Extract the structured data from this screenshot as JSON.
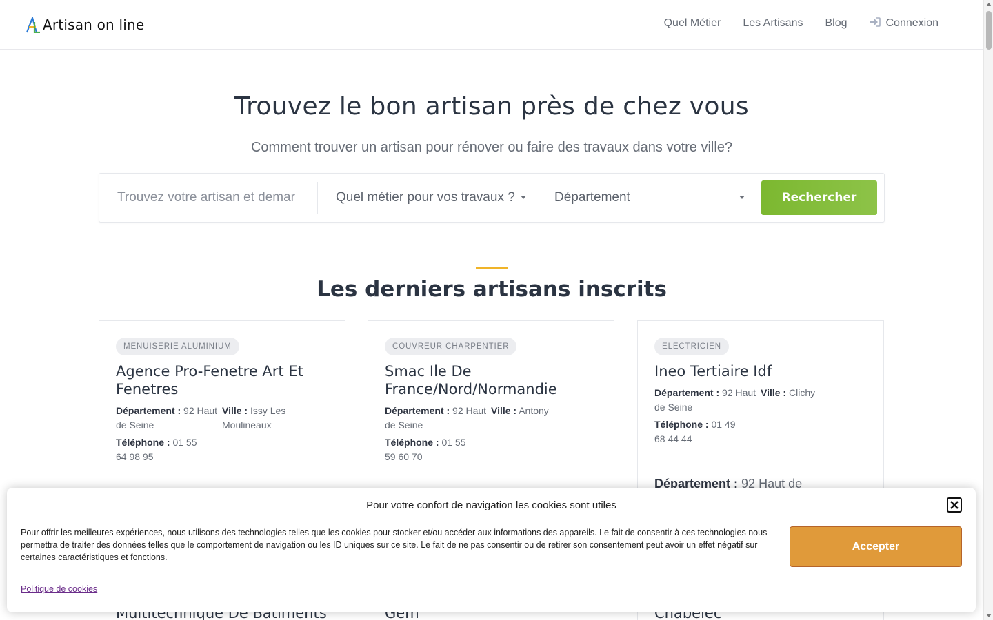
{
  "header": {
    "logo_text": "Artisan on line",
    "nav": [
      {
        "label": "Quel Métier"
      },
      {
        "label": "Les Artisans"
      },
      {
        "label": "Blog"
      },
      {
        "label": "Connexion",
        "icon": "sign-in-icon"
      }
    ]
  },
  "hero": {
    "title": "Trouvez le bon artisan près de chez vous",
    "subtitle": "Comment trouver un artisan pour rénover ou faire des travaux dans votre ville?"
  },
  "search": {
    "placeholder": "Trouvez votre artisan et demar",
    "metier_select": "Quel métier pour vos travaux ?",
    "departement_select": "Département",
    "button_label": "Rechercher"
  },
  "section": {
    "title": "Les derniers artisans inscrits"
  },
  "cards": [
    {
      "badge": "Menuiserie Aluminium",
      "name": "Agence Pro-Fenetre Art Et Fenetres",
      "dept_label": "Département :",
      "dept_value": "92 Haut de Seine",
      "ville_label": "Ville :",
      "ville_value": "Issy Les Moulineaux",
      "tel_label": "Téléphone :",
      "tel_value": "01 55 64 98 95",
      "next_name": "Multitechnique De Batiments"
    },
    {
      "badge": "Couvreur Charpentier",
      "name": "Smac Ile De France/Nord/Normandie",
      "dept_label": "Département :",
      "dept_value": "92 Haut de Seine",
      "ville_label": "Ville :",
      "ville_value": "Antony",
      "tel_label": "Téléphone :",
      "tel_value": "01 55 59 60 70",
      "next_name": "Gem"
    },
    {
      "badge": "Electricien",
      "name": "Ineo Tertiaire Idf",
      "dept_label": "Département :",
      "dept_value": "92 Haut de Seine",
      "ville_label": "Ville :",
      "ville_value": "Clichy",
      "tel_label": "Téléphone :",
      "tel_value": "01 49 68 44 44",
      "extra_label": "Département :",
      "extra_value": "92 Haut de",
      "next_name": "Chabelec"
    }
  ],
  "cookie": {
    "title": "Pour votre confort de navigation les cookies sont utiles",
    "text": "Pour offrir les meilleures expériences, nous utilisons des technologies telles que les cookies pour stocker et/ou accéder aux informations des appareils. Le fait de consentir à ces technologies nous permettra de traiter des données telles que le comportement de navigation ou les ID uniques sur ce site. Le fait de ne pas consentir ou de retirer son consentement peut avoir un effet négatif sur certaines caractéristiques et fonctions.",
    "accept_label": "Accepter",
    "policy_link": "Politique de cookies"
  },
  "colors": {
    "accent_green": "#7cb830",
    "accent_yellow": "#f0b429",
    "accept_orange": "#e09a3a",
    "link_purple": "#6b2d8a"
  }
}
